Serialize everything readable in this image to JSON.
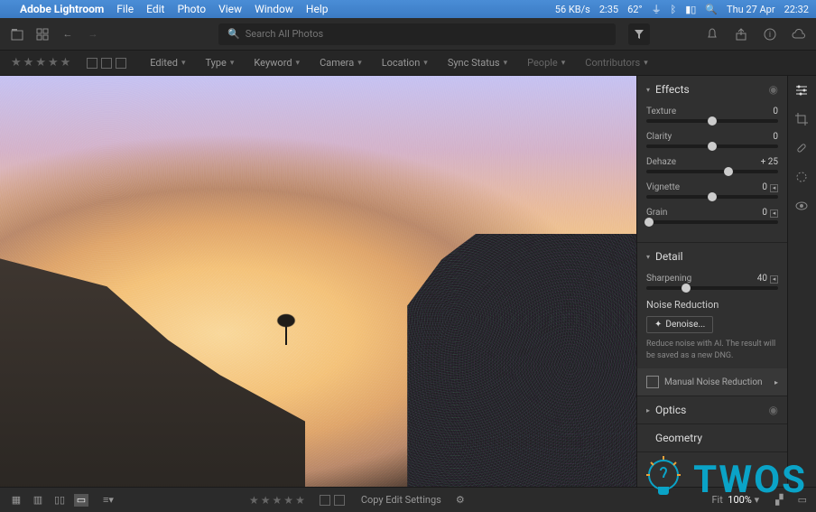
{
  "menubar": {
    "app": "Adobe Lightroom",
    "items": [
      "File",
      "Edit",
      "Photo",
      "View",
      "Window",
      "Help"
    ],
    "status": {
      "net": "56 KB/s",
      "time": "2:35",
      "temp": "62°",
      "date": "Thu 27 Apr",
      "clock": "22:32"
    }
  },
  "search": {
    "placeholder": "Search All Photos"
  },
  "filters": {
    "items": [
      {
        "label": "Edited",
        "dim": false
      },
      {
        "label": "Type",
        "dim": false
      },
      {
        "label": "Keyword",
        "dim": false
      },
      {
        "label": "Camera",
        "dim": false
      },
      {
        "label": "Location",
        "dim": false
      },
      {
        "label": "Sync Status",
        "dim": false
      },
      {
        "label": "People",
        "dim": true
      },
      {
        "label": "Contributors",
        "dim": true
      }
    ]
  },
  "panel": {
    "effects": {
      "title": "Effects",
      "sliders": [
        {
          "name": "Texture",
          "value": "0",
          "pos": 50
        },
        {
          "name": "Clarity",
          "value": "0",
          "pos": 50
        },
        {
          "name": "Dehaze",
          "value": "+ 25",
          "pos": 62
        },
        {
          "name": "Vignette",
          "value": "0",
          "pos": 50,
          "reset": true
        },
        {
          "name": "Grain",
          "value": "0",
          "pos": 2,
          "reset": true
        }
      ]
    },
    "detail": {
      "title": "Detail",
      "sharpening": {
        "name": "Sharpening",
        "value": "40",
        "pos": 30,
        "reset": true
      },
      "noise_h": "Noise Reduction",
      "denoise": "Denoise...",
      "hint": "Reduce noise with AI. The result will be saved as a new DNG.",
      "mnr": "Manual Noise Reduction"
    },
    "optics": {
      "title": "Optics"
    },
    "geometry": {
      "title": "Geometry"
    }
  },
  "bottom": {
    "copy": "Copy Edit Settings",
    "fit_label": "Fit",
    "fit_value": "100%"
  },
  "watermark": {
    "text": "TWOS"
  }
}
